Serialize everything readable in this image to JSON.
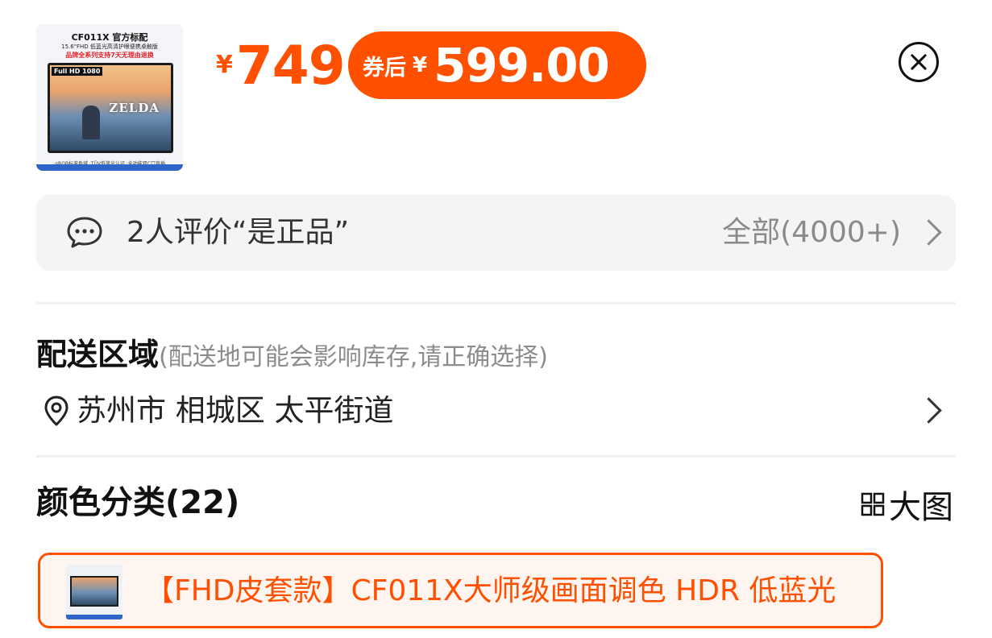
{
  "product": {
    "thumbnail": {
      "title": "CF011X 官方标配",
      "subtitle": "15.6\"FHD 低蓝光高清护眼便携桌触版",
      "promo": "品牌全系列支持7天无理由退换",
      "hd_badge": "Full HD 1080",
      "game_logo": "ZELDA",
      "footer": "·sRGB标准色域 ·TÜV低蓝光认证 ·全功能双C口盲插"
    },
    "original_price_symbol": "¥",
    "original_price": "749",
    "coupon_label": "券后",
    "coupon_price_symbol": "¥",
    "coupon_price": "599.00",
    "close_icon": "close-circle-icon"
  },
  "reviews": {
    "icon": "chat-bubble-icon",
    "summary": "2人评价“是正品”",
    "all_link": "全部(4000+)"
  },
  "delivery": {
    "title": "配送区域",
    "hint": "(配送地可能会影响库存,请正确选择)",
    "icon": "location-pin-icon",
    "address": "苏州市 相城区 太平街道"
  },
  "colors": {
    "title": "颜色分类(22)",
    "big_image_label": "大图",
    "big_image_icon": "grid-icon",
    "selected_variant": "【FHD皮套款】CF011X大师级画面调色 HDR 低蓝光"
  },
  "theme": {
    "accent": "#ff5000",
    "panel_bg": "#f4f4f4",
    "muted_text": "#8c8c8c"
  }
}
